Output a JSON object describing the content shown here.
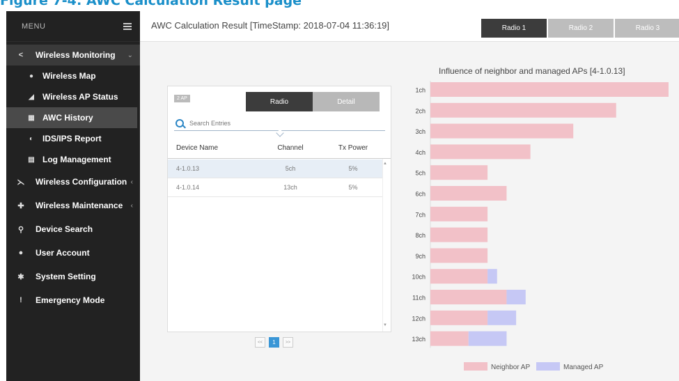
{
  "figure_caption": "Figure 7-4: AWC Calculation Result page",
  "sidebar": {
    "menu_label": "MENU",
    "items": [
      {
        "label": "Wireless Monitoring",
        "icon": "share-icon",
        "open": true,
        "children": [
          {
            "label": "Wireless Map",
            "icon": "map-pin-icon"
          },
          {
            "label": "Wireless AP Status",
            "icon": "signal-icon"
          },
          {
            "label": "AWC History",
            "icon": "calculator-icon",
            "active": true
          },
          {
            "label": "IDS/IPS Report",
            "icon": "globe-icon"
          },
          {
            "label": "Log Management",
            "icon": "document-icon"
          }
        ]
      },
      {
        "label": "Wireless Configuration",
        "icon": "antenna-icon"
      },
      {
        "label": "Wireless Maintenance",
        "icon": "wrench-icon"
      },
      {
        "label": "Device Search",
        "icon": "search-icon"
      },
      {
        "label": "User Account",
        "icon": "user-icon"
      },
      {
        "label": "System Setting",
        "icon": "gear-icon"
      },
      {
        "label": "Emergency Mode",
        "icon": "exclamation-icon"
      }
    ]
  },
  "header": {
    "title": "AWC Calculation Result [TimeStamp: 2018-07-04 11:36:19]",
    "radio_tabs": [
      "Radio 1",
      "Radio 2",
      "Radio 3"
    ],
    "active_radio": 0
  },
  "panel": {
    "ap_badge": "2 AP",
    "segments": [
      "Radio",
      "Detail"
    ],
    "active_segment": 0,
    "search_placeholder": "Search Entries",
    "columns": [
      "Device Name",
      "Channel",
      "Tx Power"
    ],
    "rows": [
      {
        "device": "4-1.0.13",
        "channel": "5ch",
        "tx_power": "5%"
      },
      {
        "device": "4-1.0.14",
        "channel": "13ch",
        "tx_power": "5%"
      }
    ],
    "pagination": {
      "prev": "<<",
      "current": "1",
      "next": ">>"
    }
  },
  "chart_data": {
    "type": "bar",
    "orientation": "horizontal",
    "stacked": true,
    "title": "Influence of neighbor and managed APs [4-1.0.13]",
    "categories": [
      "1ch",
      "2ch",
      "3ch",
      "4ch",
      "5ch",
      "6ch",
      "7ch",
      "8ch",
      "9ch",
      "10ch",
      "11ch",
      "12ch",
      "13ch"
    ],
    "series": [
      {
        "name": "Neighbor AP",
        "color": "#f2c1c8",
        "values": [
          100,
          78,
          60,
          42,
          24,
          32,
          24,
          24,
          24,
          24,
          32,
          24,
          16
        ]
      },
      {
        "name": "Managed AP",
        "color": "#c6c8f5",
        "values": [
          0,
          0,
          0,
          0,
          0,
          0,
          0,
          0,
          0,
          4,
          8,
          12,
          16
        ]
      }
    ],
    "xlim": [
      0,
      100
    ],
    "legend": "bottom",
    "grid": false
  }
}
